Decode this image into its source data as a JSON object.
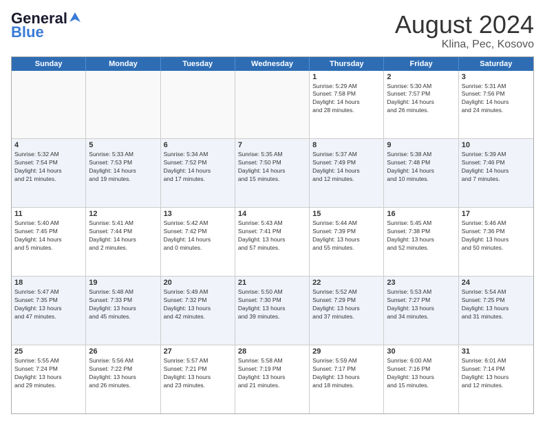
{
  "header": {
    "logo_general": "General",
    "logo_blue": "Blue",
    "month_title": "August 2024",
    "location": "Klina, Pec, Kosovo"
  },
  "days_of_week": [
    "Sunday",
    "Monday",
    "Tuesday",
    "Wednesday",
    "Thursday",
    "Friday",
    "Saturday"
  ],
  "weeks": [
    [
      {
        "day": "",
        "text": ""
      },
      {
        "day": "",
        "text": ""
      },
      {
        "day": "",
        "text": ""
      },
      {
        "day": "",
        "text": ""
      },
      {
        "day": "1",
        "text": "Sunrise: 5:29 AM\nSunset: 7:58 PM\nDaylight: 14 hours\nand 28 minutes."
      },
      {
        "day": "2",
        "text": "Sunrise: 5:30 AM\nSunset: 7:57 PM\nDaylight: 14 hours\nand 26 minutes."
      },
      {
        "day": "3",
        "text": "Sunrise: 5:31 AM\nSunset: 7:56 PM\nDaylight: 14 hours\nand 24 minutes."
      }
    ],
    [
      {
        "day": "4",
        "text": "Sunrise: 5:32 AM\nSunset: 7:54 PM\nDaylight: 14 hours\nand 21 minutes."
      },
      {
        "day": "5",
        "text": "Sunrise: 5:33 AM\nSunset: 7:53 PM\nDaylight: 14 hours\nand 19 minutes."
      },
      {
        "day": "6",
        "text": "Sunrise: 5:34 AM\nSunset: 7:52 PM\nDaylight: 14 hours\nand 17 minutes."
      },
      {
        "day": "7",
        "text": "Sunrise: 5:35 AM\nSunset: 7:50 PM\nDaylight: 14 hours\nand 15 minutes."
      },
      {
        "day": "8",
        "text": "Sunrise: 5:37 AM\nSunset: 7:49 PM\nDaylight: 14 hours\nand 12 minutes."
      },
      {
        "day": "9",
        "text": "Sunrise: 5:38 AM\nSunset: 7:48 PM\nDaylight: 14 hours\nand 10 minutes."
      },
      {
        "day": "10",
        "text": "Sunrise: 5:39 AM\nSunset: 7:46 PM\nDaylight: 14 hours\nand 7 minutes."
      }
    ],
    [
      {
        "day": "11",
        "text": "Sunrise: 5:40 AM\nSunset: 7:45 PM\nDaylight: 14 hours\nand 5 minutes."
      },
      {
        "day": "12",
        "text": "Sunrise: 5:41 AM\nSunset: 7:44 PM\nDaylight: 14 hours\nand 2 minutes."
      },
      {
        "day": "13",
        "text": "Sunrise: 5:42 AM\nSunset: 7:42 PM\nDaylight: 14 hours\nand 0 minutes."
      },
      {
        "day": "14",
        "text": "Sunrise: 5:43 AM\nSunset: 7:41 PM\nDaylight: 13 hours\nand 57 minutes."
      },
      {
        "day": "15",
        "text": "Sunrise: 5:44 AM\nSunset: 7:39 PM\nDaylight: 13 hours\nand 55 minutes."
      },
      {
        "day": "16",
        "text": "Sunrise: 5:45 AM\nSunset: 7:38 PM\nDaylight: 13 hours\nand 52 minutes."
      },
      {
        "day": "17",
        "text": "Sunrise: 5:46 AM\nSunset: 7:36 PM\nDaylight: 13 hours\nand 50 minutes."
      }
    ],
    [
      {
        "day": "18",
        "text": "Sunrise: 5:47 AM\nSunset: 7:35 PM\nDaylight: 13 hours\nand 47 minutes."
      },
      {
        "day": "19",
        "text": "Sunrise: 5:48 AM\nSunset: 7:33 PM\nDaylight: 13 hours\nand 45 minutes."
      },
      {
        "day": "20",
        "text": "Sunrise: 5:49 AM\nSunset: 7:32 PM\nDaylight: 13 hours\nand 42 minutes."
      },
      {
        "day": "21",
        "text": "Sunrise: 5:50 AM\nSunset: 7:30 PM\nDaylight: 13 hours\nand 39 minutes."
      },
      {
        "day": "22",
        "text": "Sunrise: 5:52 AM\nSunset: 7:29 PM\nDaylight: 13 hours\nand 37 minutes."
      },
      {
        "day": "23",
        "text": "Sunrise: 5:53 AM\nSunset: 7:27 PM\nDaylight: 13 hours\nand 34 minutes."
      },
      {
        "day": "24",
        "text": "Sunrise: 5:54 AM\nSunset: 7:25 PM\nDaylight: 13 hours\nand 31 minutes."
      }
    ],
    [
      {
        "day": "25",
        "text": "Sunrise: 5:55 AM\nSunset: 7:24 PM\nDaylight: 13 hours\nand 29 minutes."
      },
      {
        "day": "26",
        "text": "Sunrise: 5:56 AM\nSunset: 7:22 PM\nDaylight: 13 hours\nand 26 minutes."
      },
      {
        "day": "27",
        "text": "Sunrise: 5:57 AM\nSunset: 7:21 PM\nDaylight: 13 hours\nand 23 minutes."
      },
      {
        "day": "28",
        "text": "Sunrise: 5:58 AM\nSunset: 7:19 PM\nDaylight: 13 hours\nand 21 minutes."
      },
      {
        "day": "29",
        "text": "Sunrise: 5:59 AM\nSunset: 7:17 PM\nDaylight: 13 hours\nand 18 minutes."
      },
      {
        "day": "30",
        "text": "Sunrise: 6:00 AM\nSunset: 7:16 PM\nDaylight: 13 hours\nand 15 minutes."
      },
      {
        "day": "31",
        "text": "Sunrise: 6:01 AM\nSunset: 7:14 PM\nDaylight: 13 hours\nand 12 minutes."
      }
    ]
  ],
  "alt_rows": [
    1,
    3
  ]
}
